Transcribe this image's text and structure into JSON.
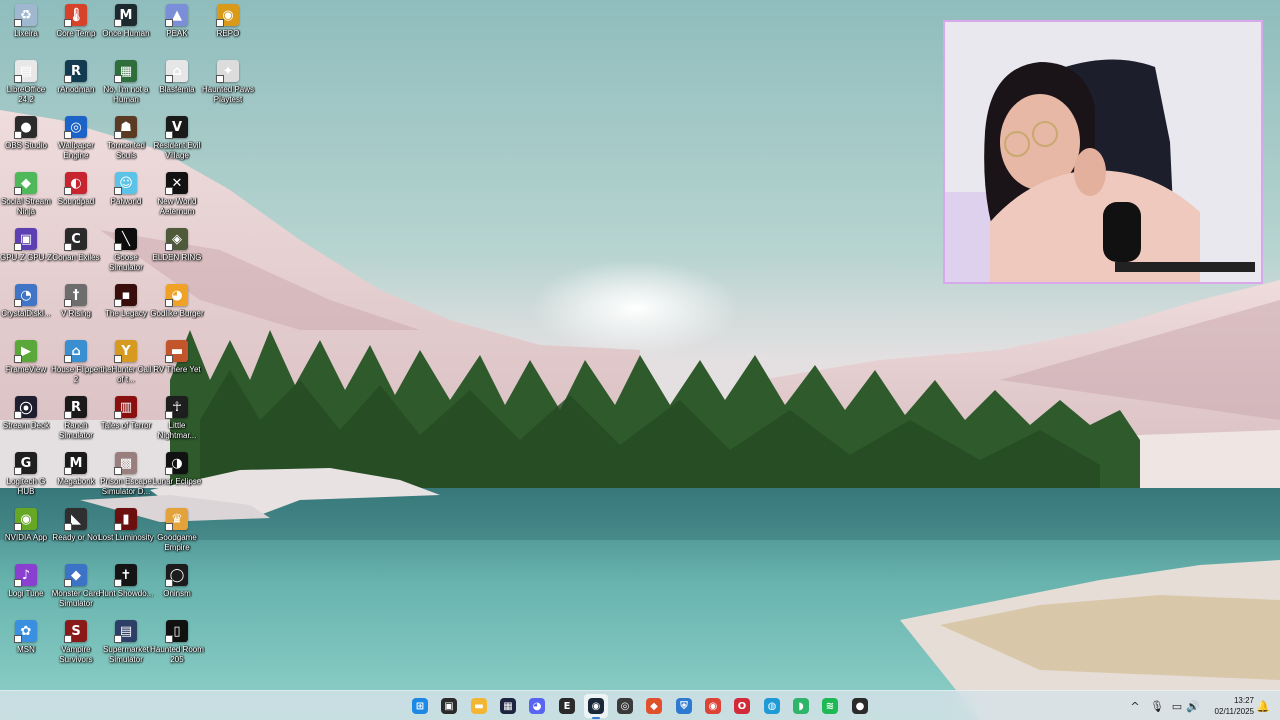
{
  "desktop": {
    "icons": [
      {
        "label": "Lixeira",
        "glyph": "♻",
        "color": "#9fb8cf",
        "icon": "recycle-bin-icon"
      },
      {
        "label": "Core Temp",
        "glyph": "🌡",
        "color": "#d7422b",
        "icon": "thermometer-icon"
      },
      {
        "label": "Once Human",
        "glyph": "M",
        "color": "#1c2a2f",
        "icon": "once-human-icon"
      },
      {
        "label": "PEAK",
        "glyph": "▲",
        "color": "#7a8fd8",
        "icon": "peak-icon"
      },
      {
        "label": "REPO",
        "glyph": "◉",
        "color": "#d99a1a",
        "icon": "repo-icon"
      },
      {
        "label": "LibreOffice 24.2",
        "glyph": "▤",
        "color": "#e8e8e8",
        "icon": "libreoffice-icon"
      },
      {
        "label": "rAnodman",
        "glyph": "R",
        "color": "#123b52",
        "icon": "r-app-icon"
      },
      {
        "label": "No, I'm not a Human",
        "glyph": "▦",
        "color": "#2e6e3a",
        "icon": "no-im-not-a-human-icon"
      },
      {
        "label": "Blasfemia",
        "glyph": "⌂",
        "color": "#e6e6e6",
        "icon": "blasfemia-icon"
      },
      {
        "label": "Haunted Paws Playtest",
        "glyph": "✦",
        "color": "#dcdcdc",
        "icon": "haunted-paws-icon"
      },
      {
        "label": "OBS Studio",
        "glyph": "●",
        "color": "#2b2b2b",
        "icon": "obs-studio-icon"
      },
      {
        "label": "Wallpaper Engine",
        "glyph": "◎",
        "color": "#1b63c8",
        "icon": "wallpaper-engine-icon"
      },
      {
        "label": "Tormented Souls",
        "glyph": "☗",
        "color": "#5a3a22",
        "icon": "tormented-souls-icon"
      },
      {
        "label": "Resident Evil Village",
        "glyph": "V",
        "color": "#1a1a1a",
        "icon": "resident-evil-village-icon"
      },
      {
        "label": "Social Stream Ninja",
        "glyph": "◆",
        "color": "#4fb85a",
        "icon": "social-stream-ninja-icon"
      },
      {
        "label": "Soundpad",
        "glyph": "◐",
        "color": "#c8242f",
        "icon": "soundpad-icon"
      },
      {
        "label": "Palworld",
        "glyph": "☺",
        "color": "#5bc3e8",
        "icon": "palworld-icon"
      },
      {
        "label": "New World Aeternum",
        "glyph": "✕",
        "color": "#111111",
        "icon": "new-world-icon"
      },
      {
        "label": "GPU-Z GPU-Z",
        "glyph": "▣",
        "color": "#5b3fb3",
        "icon": "gpu-z-icon"
      },
      {
        "label": "Conan Exiles",
        "glyph": "C",
        "color": "#2a2a2a",
        "icon": "conan-exiles-icon"
      },
      {
        "label": "Goose Simulator",
        "glyph": "╲",
        "color": "#0d0d0d",
        "icon": "goose-simulator-icon"
      },
      {
        "label": "ELDEN RING",
        "glyph": "◈",
        "color": "#4f5a3a",
        "icon": "elden-ring-icon"
      },
      {
        "label": "CrystalDiskI...",
        "glyph": "◔",
        "color": "#3f74c7",
        "icon": "crystaldisk-icon"
      },
      {
        "label": "V Rising",
        "glyph": "†",
        "color": "#6d6d6d",
        "icon": "v-rising-icon"
      },
      {
        "label": "The Legacy",
        "glyph": "▪",
        "color": "#3a0d0d",
        "icon": "the-legacy-icon"
      },
      {
        "label": "Godlike Burger",
        "glyph": "◕",
        "color": "#f0a226",
        "icon": "godlike-burger-icon"
      },
      {
        "label": "FrameView",
        "glyph": "▶",
        "color": "#5aa83a",
        "icon": "frameview-icon"
      },
      {
        "label": "House Flipper 2",
        "glyph": "⌂",
        "color": "#3a8fd0",
        "icon": "house-flipper-icon"
      },
      {
        "label": "theHunter Call of t...",
        "glyph": "Y",
        "color": "#d59a1f",
        "icon": "thehunter-icon"
      },
      {
        "label": "RV There Yet",
        "glyph": "▬",
        "color": "#c2552c",
        "icon": "rv-there-yet-icon"
      },
      {
        "label": "Stream Deck",
        "glyph": "⦿",
        "color": "#1e1e2e",
        "icon": "stream-deck-icon"
      },
      {
        "label": "Ranch Simulator",
        "glyph": "R",
        "color": "#1a1a1a",
        "icon": "ranch-simulator-icon"
      },
      {
        "label": "Tales of Terror",
        "glyph": "▥",
        "color": "#8a1010",
        "icon": "tales-of-terror-icon"
      },
      {
        "label": "Little Nightmar...",
        "glyph": "☥",
        "color": "#1e1e1e",
        "icon": "little-nightmares-icon"
      },
      {
        "label": "Logitech G HUB",
        "glyph": "G",
        "color": "#1f1f1f",
        "icon": "logitech-ghub-icon"
      },
      {
        "label": "Megabonk",
        "glyph": "M",
        "color": "#1a1a1a",
        "icon": "megabonk-icon"
      },
      {
        "label": "Prison Escape Simulator D...",
        "glyph": "▩",
        "color": "#9a7f7f",
        "icon": "prison-escape-icon"
      },
      {
        "label": "Lunar Eclipse",
        "glyph": "◑",
        "color": "#111111",
        "icon": "lunar-eclipse-icon"
      },
      {
        "label": "NVIDIA App",
        "glyph": "◉",
        "color": "#66a823",
        "icon": "nvidia-app-icon"
      },
      {
        "label": "Ready or Not",
        "glyph": "◣",
        "color": "#2f2f2f",
        "icon": "ready-or-not-icon"
      },
      {
        "label": "Lost Luminosity",
        "glyph": "▮",
        "color": "#6b0f0f",
        "icon": "lost-luminosity-icon"
      },
      {
        "label": "Goodgame Empire",
        "glyph": "♛",
        "color": "#e4a23a",
        "icon": "goodgame-empire-icon"
      },
      {
        "label": "Logi Tune",
        "glyph": "♪",
        "color": "#8b3fd1",
        "icon": "logi-tune-icon"
      },
      {
        "label": "Monster Care Simulator",
        "glyph": "◆",
        "color": "#3c73c6",
        "icon": "monster-care-icon"
      },
      {
        "label": "Hunt Showdo...",
        "glyph": "✝",
        "color": "#141414",
        "icon": "hunt-showdown-icon"
      },
      {
        "label": "Oninsm",
        "glyph": "◯",
        "color": "#1c1c1c",
        "icon": "oninsm-icon"
      },
      {
        "label": "MSN",
        "glyph": "✿",
        "color": "#3a8fe0",
        "icon": "msn-icon"
      },
      {
        "label": "Vampire Survivors",
        "glyph": "S",
        "color": "#8a1a1a",
        "icon": "vampire-survivors-icon"
      },
      {
        "label": "Supermarket Simulator",
        "glyph": "▤",
        "color": "#2d3f66",
        "icon": "supermarket-simulator-icon"
      },
      {
        "label": "Haunted Room 205",
        "glyph": "▯",
        "color": "#111111",
        "icon": "haunted-room-icon"
      }
    ]
  },
  "taskbar": {
    "apps": [
      {
        "icon": "windows-start-icon",
        "glyph": "⊞",
        "color": "#1e88e5"
      },
      {
        "icon": "task-view-icon",
        "glyph": "▣",
        "color": "#2b2b2b"
      },
      {
        "icon": "file-explorer-icon",
        "glyph": "▬",
        "color": "#f2b632"
      },
      {
        "icon": "terminal-icon",
        "glyph": "▦",
        "color": "#1c2440"
      },
      {
        "icon": "discord-icon",
        "glyph": "◕",
        "color": "#5865f2"
      },
      {
        "icon": "epic-games-icon",
        "glyph": "E",
        "color": "#2a2a2a"
      },
      {
        "icon": "steam-icon",
        "glyph": "◉",
        "color": "#1b2838"
      },
      {
        "icon": "obs-icon",
        "glyph": "◎",
        "color": "#3a3a3a"
      },
      {
        "icon": "brave-icon",
        "glyph": "◆",
        "color": "#e0502a"
      },
      {
        "icon": "bitwarden-icon",
        "glyph": "⛨",
        "color": "#2e7ad0"
      },
      {
        "icon": "chrome-icon",
        "glyph": "◉",
        "color": "#db4437"
      },
      {
        "icon": "opera-icon",
        "glyph": "O",
        "color": "#d32a3a"
      },
      {
        "icon": "edge-icon",
        "glyph": "◍",
        "color": "#1e9ad6"
      },
      {
        "icon": "stream-icon",
        "glyph": "◗",
        "color": "#2fb56a"
      },
      {
        "icon": "spotify-icon",
        "glyph": "≋",
        "color": "#1db954"
      },
      {
        "icon": "obs-studio-taskbar-icon",
        "glyph": "●",
        "color": "#2b2b2b"
      }
    ],
    "active_index": 6,
    "clock": {
      "time": "13:27",
      "date": "02/11/2025"
    }
  }
}
